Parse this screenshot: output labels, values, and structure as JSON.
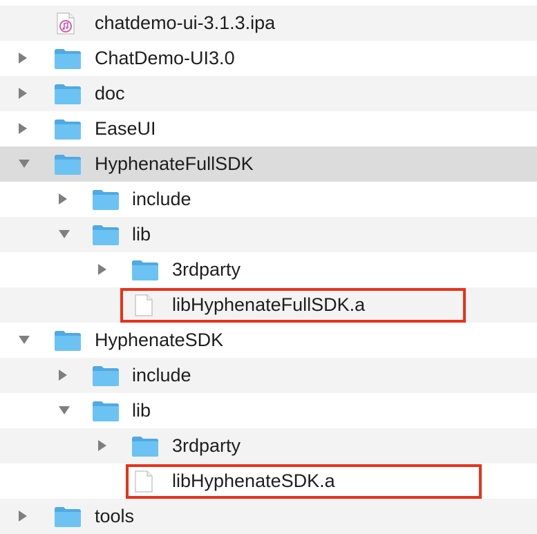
{
  "colors": {
    "highlight": "#e8311a",
    "folder": "#5fb8ef",
    "row_alt": "#f3f3f3",
    "row_selected": "#dcdcdc"
  },
  "tree": {
    "rows": [
      {
        "label": "chatdemo-ui-3.1.3.ipa",
        "kind": "ipa-file",
        "expanded": null
      },
      {
        "label": "ChatDemo-UI3.0",
        "kind": "folder",
        "expanded": false
      },
      {
        "label": "doc",
        "kind": "folder",
        "expanded": false
      },
      {
        "label": "EaseUI",
        "kind": "folder",
        "expanded": false
      },
      {
        "label": "HyphenateFullSDK",
        "kind": "folder",
        "expanded": true,
        "selected": true
      },
      {
        "label": "include",
        "kind": "folder",
        "expanded": false
      },
      {
        "label": "lib",
        "kind": "folder",
        "expanded": true
      },
      {
        "label": "3rdparty",
        "kind": "folder",
        "expanded": false
      },
      {
        "label": "libHyphenateFullSDK.a",
        "kind": "file",
        "expanded": null,
        "highlighted": true
      },
      {
        "label": "HyphenateSDK",
        "kind": "folder",
        "expanded": true
      },
      {
        "label": "include",
        "kind": "folder",
        "expanded": false
      },
      {
        "label": "lib",
        "kind": "folder",
        "expanded": true
      },
      {
        "label": "3rdparty",
        "kind": "folder",
        "expanded": false
      },
      {
        "label": "libHyphenateSDK.a",
        "kind": "file",
        "expanded": null,
        "highlighted": true
      },
      {
        "label": "tools",
        "kind": "folder",
        "expanded": false
      }
    ]
  }
}
